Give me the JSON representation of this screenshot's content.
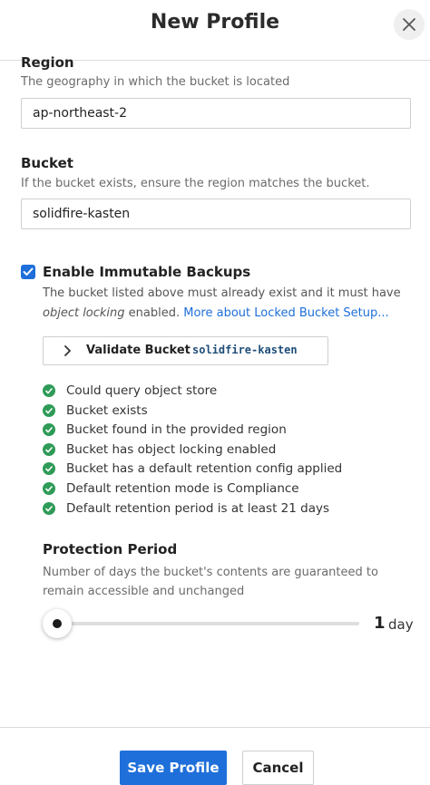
{
  "dialog": {
    "title": "New Profile",
    "close_icon": "close-icon"
  },
  "region": {
    "label": "Region",
    "help": "The geography in which the bucket is located",
    "value": "ap-northeast-2"
  },
  "bucket": {
    "label": "Bucket",
    "help": "If the bucket exists, ensure the region matches the bucket.",
    "value": "solidfire-kasten"
  },
  "immutable": {
    "checked": true,
    "label": "Enable Immutable Backups",
    "desc_prefix": "The bucket listed above must already exist and it must have ",
    "desc_em": "object locking",
    "desc_suffix": " enabled. ",
    "link": "More about Locked Bucket Setup..."
  },
  "validate": {
    "label": "Validate Bucket",
    "bucket_name": "solidfire-kasten"
  },
  "checks": [
    "Could query object store",
    "Bucket exists",
    "Bucket found in the provided region",
    "Bucket has object locking enabled",
    "Bucket has a default retention config applied",
    "Default retention mode is Compliance",
    "Default retention period is at least 21 days"
  ],
  "protection": {
    "label": "Protection Period",
    "help": "Number of days the bucket's contents are guaranteed to remain accessible and unchanged",
    "value": "1",
    "unit": "day",
    "slider_level": 0
  },
  "footer": {
    "save_label": "Save Profile",
    "cancel_label": "Cancel"
  },
  "colors": {
    "accent": "#1e6fd9",
    "success": "#2e9b57"
  }
}
